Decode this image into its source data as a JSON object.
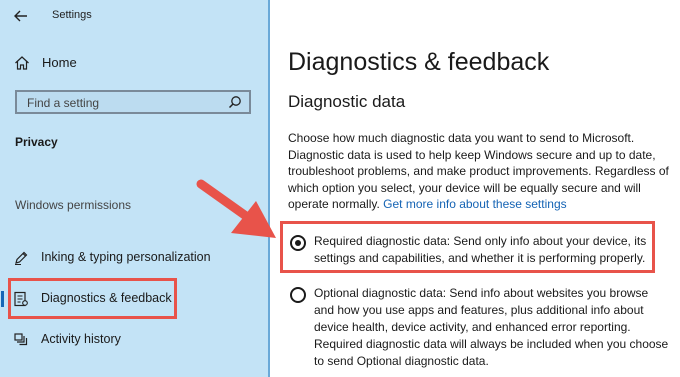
{
  "window": {
    "title": "Settings"
  },
  "sidebar": {
    "home_label": "Home",
    "search_placeholder": "Find a setting",
    "section_title": "Privacy",
    "group_label": "Windows permissions",
    "items": [
      {
        "label": "Inking & typing personalization",
        "icon": "pen-icon"
      },
      {
        "label": "Diagnostics & feedback",
        "icon": "diagnostics-icon",
        "active": true
      },
      {
        "label": "Activity history",
        "icon": "activity-icon"
      }
    ]
  },
  "main": {
    "title": "Diagnostics & feedback",
    "subtitle": "Diagnostic data",
    "description": "Choose how much diagnostic data you want to send to Microsoft. Diagnostic data is used to help keep Windows secure and up to date, troubleshoot problems, and make product improvements. Regardless of which option you select, your device will be equally secure and will operate normally.",
    "link": "Get more info about these settings",
    "options": [
      {
        "text": "Required diagnostic data: Send only info about your device, its settings and capabilities, and whether it is performing properly.",
        "selected": true
      },
      {
        "text": "Optional diagnostic data: Send info about websites you browse and how you use apps and features, plus additional info about device health, device activity, and enhanced error reporting. Required diagnostic data will always be included when you choose to send Optional diagnostic data.",
        "selected": false
      }
    ]
  },
  "colors": {
    "sidebar_bg": "#c3e3f6",
    "accent": "#1463b4",
    "annotation": "#e8534a"
  }
}
